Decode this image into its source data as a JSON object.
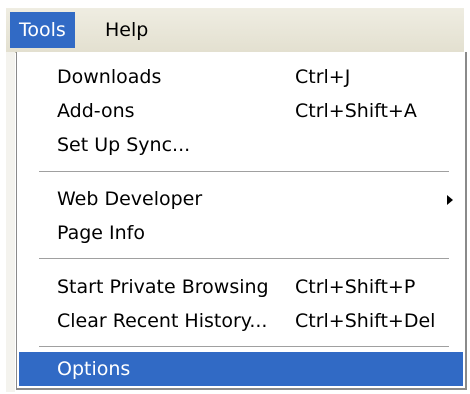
{
  "menubar": {
    "tools_label": "Tools",
    "help_label": "Help"
  },
  "tools_menu": {
    "items": [
      {
        "label": "Downloads",
        "shortcut": "Ctrl+J"
      },
      {
        "label": "Add-ons",
        "shortcut": "Ctrl+Shift+A"
      },
      {
        "label": "Set Up Sync...",
        "shortcut": ""
      },
      {
        "label": "Web Developer",
        "shortcut": "",
        "submenu_icon": "submenu-arrow-icon"
      },
      {
        "label": "Page Info",
        "shortcut": ""
      },
      {
        "label": "Start Private Browsing",
        "shortcut": "Ctrl+Shift+P"
      },
      {
        "label": "Clear Recent History...",
        "shortcut": "Ctrl+Shift+Del"
      },
      {
        "label": "Options",
        "shortcut": "",
        "selected": true
      }
    ]
  },
  "colors": {
    "highlight": "#316ac5",
    "menubar_bg": "#ece9d8",
    "separator": "#a0a0a0"
  }
}
